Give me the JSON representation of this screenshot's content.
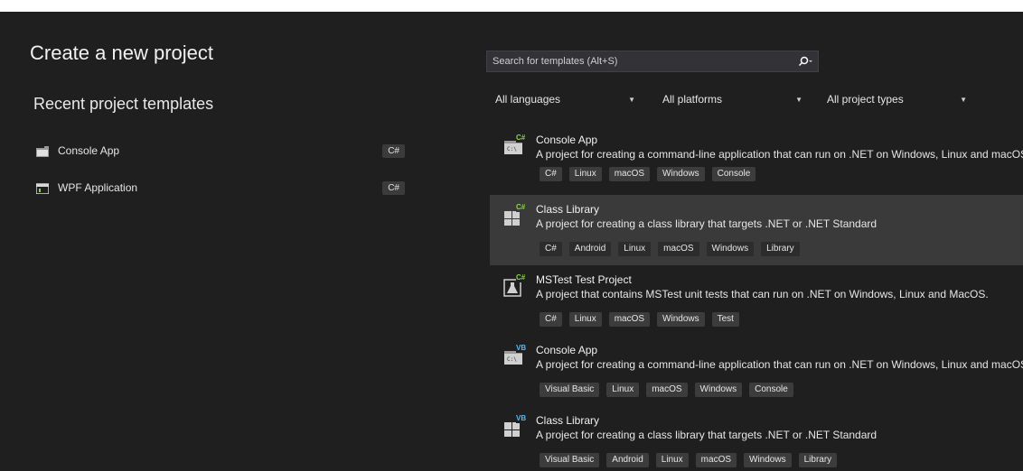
{
  "title": "Create a new project",
  "recent": {
    "heading": "Recent project templates",
    "items": [
      {
        "label": "Console App",
        "lang": "C#"
      },
      {
        "label": "WPF Application",
        "lang": "C#"
      }
    ]
  },
  "search": {
    "placeholder": "Search for templates (Alt+S)"
  },
  "filters": {
    "language": "All languages",
    "platform": "All platforms",
    "project_type": "All project types"
  },
  "templates": [
    {
      "name": "Console App",
      "lang_badge": "C#",
      "desc": "A project for creating a command-line application that can run on .NET on Windows, Linux and macOS",
      "tags": [
        "C#",
        "Linux",
        "macOS",
        "Windows",
        "Console"
      ]
    },
    {
      "name": "Class Library",
      "lang_badge": "C#",
      "desc": "A project for creating a class library that targets .NET or .NET Standard",
      "tags": [
        "C#",
        "Android",
        "Linux",
        "macOS",
        "Windows",
        "Library"
      ]
    },
    {
      "name": "MSTest Test Project",
      "lang_badge": "C#",
      "desc": "A project that contains MSTest unit tests that can run on .NET on Windows, Linux and MacOS.",
      "tags": [
        "C#",
        "Linux",
        "macOS",
        "Windows",
        "Test"
      ]
    },
    {
      "name": "Console App",
      "lang_badge": "VB",
      "desc": "A project for creating a command-line application that can run on .NET on Windows, Linux and macOS",
      "tags": [
        "Visual Basic",
        "Linux",
        "macOS",
        "Windows",
        "Console"
      ]
    },
    {
      "name": "Class Library",
      "lang_badge": "VB",
      "desc": "A project for creating a class library that targets .NET or .NET Standard",
      "tags": [
        "Visual Basic",
        "Android",
        "Linux",
        "macOS",
        "Windows",
        "Library"
      ]
    }
  ],
  "colors": {
    "background": "#1f1f1f",
    "selected_row": "#3a3a3a",
    "tag_bg": "#3c3c3c",
    "csharp_accent": "#8fd14f",
    "vb_accent": "#5db8f0"
  }
}
